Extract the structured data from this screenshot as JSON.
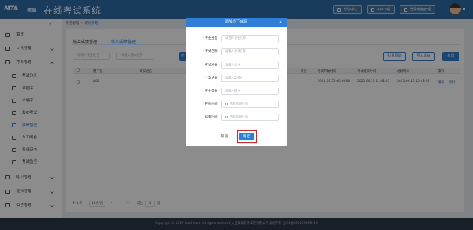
{
  "header": {
    "logo_text": "MTA",
    "logo_subtext": "美瑞",
    "app_title": "在线考试系统",
    "buttons": [
      {
        "label": "帮助中心",
        "icon": "help-icon"
      },
      {
        "label": "APP下载",
        "icon": "download-icon"
      },
      {
        "label": "登录电脑管理",
        "icon": "monitor-icon"
      }
    ]
  },
  "sidebar": {
    "collapse_glyph": "‹",
    "items": [
      {
        "label": "首页",
        "icon": "home-icon"
      },
      {
        "label": "人员管理",
        "icon": "user-icon"
      },
      {
        "label": "考务管理",
        "icon": "exam-icon"
      }
    ],
    "sub_items": [
      {
        "label": "考试分析",
        "icon": "analysis-icon"
      },
      {
        "label": "试题库",
        "icon": "question-bank-icon"
      },
      {
        "label": "试卷库",
        "icon": "paper-icon"
      },
      {
        "label": "发布考试",
        "icon": "publish-icon"
      },
      {
        "label": "成绩管理",
        "icon": "score-icon",
        "active": true
      },
      {
        "label": "人工阅卷",
        "icon": "grading-icon"
      },
      {
        "label": "报名审核",
        "icon": "review-icon"
      },
      {
        "label": "考试监控",
        "icon": "monitor-icon"
      }
    ],
    "bottom_items": [
      {
        "label": "练习管理",
        "icon": "practice-icon"
      },
      {
        "label": "证书管理",
        "icon": "certificate-icon"
      },
      {
        "label": "公告管理",
        "icon": "notice-icon"
      }
    ]
  },
  "breadcrumb": {
    "parent": "考务管理",
    "separator": ">",
    "current": "成绩管理"
  },
  "tabs": [
    {
      "label": "线上成绩管理"
    },
    {
      "label": "线下成绩管理",
      "active": true
    }
  ],
  "filters": {
    "name_placeholder": "请输入考生姓名",
    "exam_placeholder": "请输入考试名称"
  },
  "actions": {
    "search": "查",
    "batch_delete": "批量删除",
    "import": "导入成绩",
    "add": "新增"
  },
  "table": {
    "columns": [
      "用户名",
      "真实姓名",
      "",
      "",
      "得分",
      "考试开始时间",
      "考试结束时间",
      "创建时间",
      "操作"
    ],
    "rows": [
      {
        "username": "888",
        "score": "",
        "start": "2021.05.31 00:00:00",
        "end": "2021.06.15 11:41:03",
        "created": "2021.06.15 10:41:05",
        "edit": "编辑",
        "delete": "删除"
      }
    ]
  },
  "pager": {
    "total": "共 1 条",
    "page_size": "10条/页",
    "prev": "‹",
    "page": "1",
    "next": "›",
    "goto_label": "前往",
    "goto_value": "1",
    "page_unit": "页"
  },
  "modal": {
    "title": "添加线下成绩",
    "close_glyph": "×",
    "fields": [
      {
        "label": "考生姓名:",
        "placeholder": "请选择考生名称",
        "required": true
      },
      {
        "label": "考试名称:",
        "placeholder": "请输入考试名称",
        "required": true
      },
      {
        "label": "考试总分:",
        "placeholder": "请输入总分",
        "required": true
      },
      {
        "label": "及格分:",
        "placeholder": "请输入及格分",
        "required": true
      },
      {
        "label": "考生得分:",
        "placeholder": "请输入得分",
        "required": true
      },
      {
        "label": "开始时间:",
        "placeholder": "选择日期时间",
        "required": true,
        "date": true
      },
      {
        "label": "结束时间:",
        "placeholder": "选择日期时间",
        "required": true,
        "date": true
      }
    ],
    "cancel": "取 消",
    "confirm": "确 定"
  },
  "footer": {
    "text": "Copyright © 2019 Ikaolh.com All rights reserved 大连美瑞软件工程有限公司 版权所有 辽ICP备09020984号-19"
  },
  "colors": {
    "primary": "#2f7fd8",
    "header": "#2f6ea8",
    "highlight": "#e02020"
  }
}
